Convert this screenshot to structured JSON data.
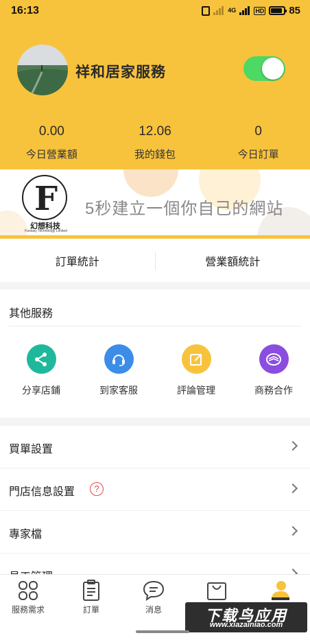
{
  "status_bar": {
    "time": "16:13",
    "network": "4G",
    "hd": "HD",
    "battery_level": 0.85,
    "battery_text": "85"
  },
  "header": {
    "shop_name": "祥和居家服務",
    "open_toggle_on": true,
    "stats": [
      {
        "value": "0.00",
        "label": "今日營業額"
      },
      {
        "value": "12.06",
        "label": "我的錢包"
      },
      {
        "value": "0",
        "label": "今日訂單"
      }
    ]
  },
  "banner": {
    "logo_letter": "F",
    "logo_cn": "幻想科技",
    "logo_en": "Fantasy Technology Limited",
    "slogan": "5秒建立一個你自己的網站"
  },
  "stat_tabs": [
    "訂單統計",
    "營業額統計"
  ],
  "services": {
    "title": "其他服務",
    "items": [
      {
        "label": "分享店鋪",
        "icon": "share-icon",
        "color": "#20b89c"
      },
      {
        "label": "到家客服",
        "icon": "headset-icon",
        "color": "#3c8de8"
      },
      {
        "label": "評論管理",
        "icon": "edit-icon",
        "color": "#f8c33c"
      },
      {
        "label": "商務合作",
        "icon": "cooperation-icon",
        "color": "#8a4de0"
      }
    ]
  },
  "settings": {
    "items": [
      {
        "label": "買單設置"
      },
      {
        "label": "門店信息設置",
        "help": "?"
      },
      {
        "label": "專家檔"
      },
      {
        "label": "員工管理"
      }
    ]
  },
  "bottom_nav": [
    {
      "label": "服務需求",
      "icon": "grid-icon"
    },
    {
      "label": "訂單",
      "icon": "clipboard-icon"
    },
    {
      "label": "消息",
      "icon": "message-icon"
    },
    {
      "label": "",
      "icon": "shopping-bag-icon"
    },
    {
      "label": "",
      "icon": "profile-icon",
      "active_color": "#f8c33c"
    }
  ],
  "watermark": {
    "main": "下载鸟应用",
    "url": "www.xiazainiao.com"
  }
}
